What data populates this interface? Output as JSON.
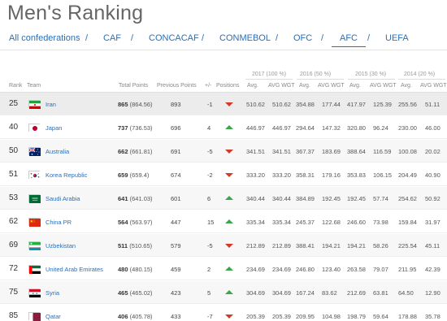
{
  "page": {
    "title": "Men's Ranking"
  },
  "nav": {
    "tabs": [
      {
        "label": "All confederations"
      },
      {
        "label": "CAF"
      },
      {
        "label": "CONCACAF"
      },
      {
        "label": "CONMEBOL"
      },
      {
        "label": "OFC"
      },
      {
        "label": "AFC"
      },
      {
        "label": "UEFA"
      }
    ],
    "separator": "/",
    "active": "AFC",
    "accent_color": "#2a6fb8"
  },
  "table": {
    "year_groups": [
      "2017 (100 %)",
      "2016 (50 %)",
      "2015 (30 %)",
      "2014 (20 %)"
    ],
    "headers": {
      "rank": "Rank",
      "team": "Team",
      "total_points": "Total Points",
      "previous_points": "Previous Points",
      "plus_minus": "+/-",
      "positions": "Positions",
      "avg": "Avg.",
      "avg_wgt": "AVG WGT"
    },
    "rows": [
      {
        "rank": "25",
        "team": "Iran",
        "flag": "iran",
        "total": "865",
        "total_paren": "(864.56)",
        "prev": "893",
        "pm": "-1",
        "dir": "down",
        "y2017_avg": "510.62",
        "y2017_wgt": "510.62",
        "y2016_avg": "354.88",
        "y2016_wgt": "177.44",
        "y2015_avg": "417.97",
        "y2015_wgt": "125.39",
        "y2014_avg": "255.56",
        "y2014_wgt": "51.11"
      },
      {
        "rank": "40",
        "team": "Japan",
        "flag": "japan",
        "total": "737",
        "total_paren": "(736.53)",
        "prev": "696",
        "pm": "4",
        "dir": "up",
        "y2017_avg": "446.97",
        "y2017_wgt": "446.97",
        "y2016_avg": "294.64",
        "y2016_wgt": "147.32",
        "y2015_avg": "320.80",
        "y2015_wgt": "96.24",
        "y2014_avg": "230.00",
        "y2014_wgt": "46.00"
      },
      {
        "rank": "50",
        "team": "Australia",
        "flag": "australia",
        "total": "662",
        "total_paren": "(661.81)",
        "prev": "691",
        "pm": "-5",
        "dir": "down",
        "y2017_avg": "341.51",
        "y2017_wgt": "341.51",
        "y2016_avg": "367.37",
        "y2016_wgt": "183.69",
        "y2015_avg": "388.64",
        "y2015_wgt": "116.59",
        "y2014_avg": "100.08",
        "y2014_wgt": "20.02"
      },
      {
        "rank": "51",
        "team": "Korea Republic",
        "flag": "korea",
        "total": "659",
        "total_paren": "(659.4)",
        "prev": "674",
        "pm": "-2",
        "dir": "down",
        "y2017_avg": "333.20",
        "y2017_wgt": "333.20",
        "y2016_avg": "358.31",
        "y2016_wgt": "179.16",
        "y2015_avg": "353.83",
        "y2015_wgt": "106.15",
        "y2014_avg": "204.49",
        "y2014_wgt": "40.90"
      },
      {
        "rank": "53",
        "team": "Saudi Arabia",
        "flag": "saudi",
        "total": "641",
        "total_paren": "(641.03)",
        "prev": "601",
        "pm": "6",
        "dir": "up",
        "y2017_avg": "340.44",
        "y2017_wgt": "340.44",
        "y2016_avg": "384.89",
        "y2016_wgt": "192.45",
        "y2015_avg": "192.45",
        "y2015_wgt": "57.74",
        "y2014_avg": "254.62",
        "y2014_wgt": "50.92"
      },
      {
        "rank": "62",
        "team": "China PR",
        "flag": "china",
        "total": "564",
        "total_paren": "(563.97)",
        "prev": "447",
        "pm": "15",
        "dir": "up",
        "y2017_avg": "335.34",
        "y2017_wgt": "335.34",
        "y2016_avg": "245.37",
        "y2016_wgt": "122.68",
        "y2015_avg": "246.60",
        "y2015_wgt": "73.98",
        "y2014_avg": "159.84",
        "y2014_wgt": "31.97"
      },
      {
        "rank": "69",
        "team": "Uzbekistan",
        "flag": "uzbekistan",
        "total": "511",
        "total_paren": "(510.65)",
        "prev": "579",
        "pm": "-5",
        "dir": "down",
        "y2017_avg": "212.89",
        "y2017_wgt": "212.89",
        "y2016_avg": "388.41",
        "y2016_wgt": "194.21",
        "y2015_avg": "194.21",
        "y2015_wgt": "58.26",
        "y2014_avg": "225.54",
        "y2014_wgt": "45.11"
      },
      {
        "rank": "72",
        "team": "United Arab Emirates",
        "flag": "uae",
        "total": "480",
        "total_paren": "(480.15)",
        "prev": "459",
        "pm": "2",
        "dir": "up",
        "y2017_avg": "234.69",
        "y2017_wgt": "234.69",
        "y2016_avg": "246.80",
        "y2016_wgt": "123.40",
        "y2015_avg": "263.58",
        "y2015_wgt": "79.07",
        "y2014_avg": "211.95",
        "y2014_wgt": "42.39"
      },
      {
        "rank": "75",
        "team": "Syria",
        "flag": "syria",
        "total": "465",
        "total_paren": "(465.02)",
        "prev": "423",
        "pm": "5",
        "dir": "up",
        "y2017_avg": "304.69",
        "y2017_wgt": "304.69",
        "y2016_avg": "167.24",
        "y2016_wgt": "83.62",
        "y2015_avg": "212.69",
        "y2015_wgt": "63.81",
        "y2014_avg": "64.50",
        "y2014_wgt": "12.90"
      },
      {
        "rank": "85",
        "team": "Qatar",
        "flag": "qatar",
        "total": "406",
        "total_paren": "(405.78)",
        "prev": "433",
        "pm": "-7",
        "dir": "down",
        "y2017_avg": "205.39",
        "y2017_wgt": "205.39",
        "y2016_avg": "209.95",
        "y2016_wgt": "104.98",
        "y2015_avg": "198.79",
        "y2015_wgt": "59.64",
        "y2014_avg": "178.88",
        "y2014_wgt": "35.78"
      }
    ]
  }
}
